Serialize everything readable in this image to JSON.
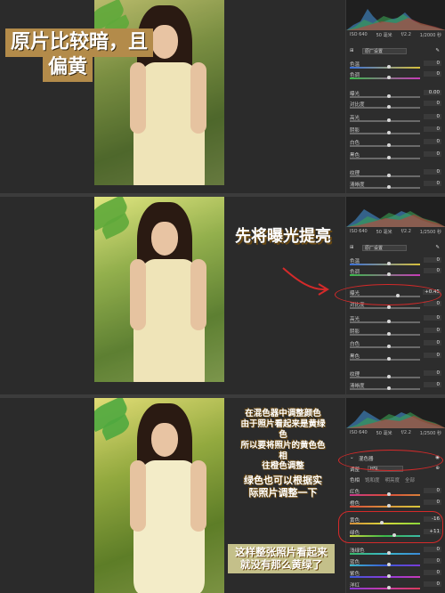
{
  "panel1": {
    "caption_line1": "原片比较暗，且",
    "caption_line2": "偏黄",
    "exif": [
      "ISO 640",
      "50 毫米",
      "f/2.2",
      "1/2000 秒"
    ],
    "profile_label": "原厂设置",
    "rows": [
      {
        "label": "色温",
        "value": "0"
      },
      {
        "label": "色调",
        "value": "0"
      },
      {
        "label": "曝光",
        "value": "0.00"
      },
      {
        "label": "对比度",
        "value": "0"
      },
      {
        "label": "高光",
        "value": "0"
      },
      {
        "label": "阴影",
        "value": "0"
      },
      {
        "label": "白色",
        "value": "0"
      },
      {
        "label": "黑色",
        "value": "0"
      },
      {
        "label": "纹理",
        "value": "0"
      },
      {
        "label": "清晰度",
        "value": "0"
      }
    ]
  },
  "panel2": {
    "caption": "先将曝光提亮",
    "exif": [
      "ISO 640",
      "50 毫米",
      "f/2.2",
      "1/2500 秒"
    ],
    "profile_label": "原厂设置",
    "rows": [
      {
        "label": "色温",
        "value": "0"
      },
      {
        "label": "色调",
        "value": "0"
      },
      {
        "label": "曝光",
        "value": "+0.45"
      },
      {
        "label": "对比度",
        "value": "0"
      },
      {
        "label": "高光",
        "value": "0"
      },
      {
        "label": "阴影",
        "value": "0"
      },
      {
        "label": "白色",
        "value": "0"
      },
      {
        "label": "黑色",
        "value": "0"
      },
      {
        "label": "纹理",
        "value": "0"
      },
      {
        "label": "清晰度",
        "value": "0"
      }
    ]
  },
  "panel3": {
    "caption_top_1": "在混色器中调整颜色",
    "caption_top_2": "由于照片看起来是黄绿色",
    "caption_top_3": "所以要将照片的黄色色相",
    "caption_top_4": "往橙色调整",
    "caption_mid_1": "绿色也可以根据实",
    "caption_mid_2": "际照片调整一下",
    "caption_bottom_1": "这样整张照片看起来",
    "caption_bottom_2": "就没有那么黄绿了",
    "exif": [
      "ISO 640",
      "50 毫米",
      "f/2.2",
      "1/2500 秒"
    ],
    "section_title": "混色器",
    "mode_label": "HSL",
    "tabs": [
      "色相",
      "饱和度",
      "明亮度",
      "全部"
    ],
    "rows": [
      {
        "label": "红色",
        "value": "0"
      },
      {
        "label": "橙色",
        "value": "0"
      },
      {
        "label": "黄色",
        "value": "-16"
      },
      {
        "label": "绿色",
        "value": "+11"
      },
      {
        "label": "浅绿色",
        "value": "0"
      },
      {
        "label": "蓝色",
        "value": "0"
      },
      {
        "label": "紫色",
        "value": "0"
      },
      {
        "label": "洋红",
        "value": "0"
      }
    ]
  }
}
